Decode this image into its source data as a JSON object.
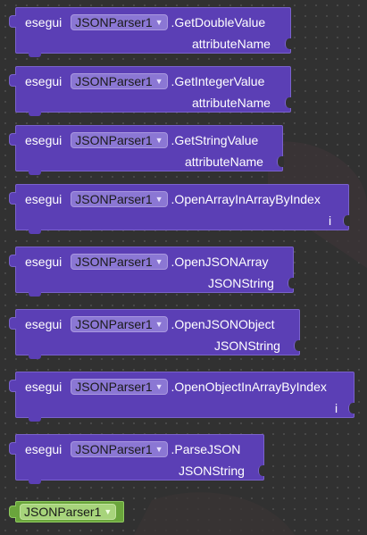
{
  "component_name": "JSONParser1",
  "dropdown_arrow": "▼",
  "blocks": [
    {
      "keyword": "esegui",
      "component": "JSONParser1",
      "method": ".GetDoubleValue",
      "param": "attributeName"
    },
    {
      "keyword": "esegui",
      "component": "JSONParser1",
      "method": ".GetIntegerValue",
      "param": "attributeName"
    },
    {
      "keyword": "esegui",
      "component": "JSONParser1",
      "method": ".GetStringValue",
      "param": "attributeName"
    },
    {
      "keyword": "esegui",
      "component": "JSONParser1",
      "method": ".OpenArrayInArrayByIndex",
      "param": "i"
    },
    {
      "keyword": "esegui",
      "component": "JSONParser1",
      "method": ".OpenJSONArray",
      "param": "JSONString"
    },
    {
      "keyword": "esegui",
      "component": "JSONParser1",
      "method": ".OpenJSONObject",
      "param": "JSONString"
    },
    {
      "keyword": "esegui",
      "component": "JSONParser1",
      "method": ".OpenObjectInArrayByIndex",
      "param": "i"
    },
    {
      "keyword": "esegui",
      "component": "JSONParser1",
      "method": ".ParseJSON",
      "param": "JSONString"
    }
  ],
  "colors": {
    "block": "#5b3fb5",
    "component_block": "#6aa53c",
    "workspace": "#313131"
  }
}
